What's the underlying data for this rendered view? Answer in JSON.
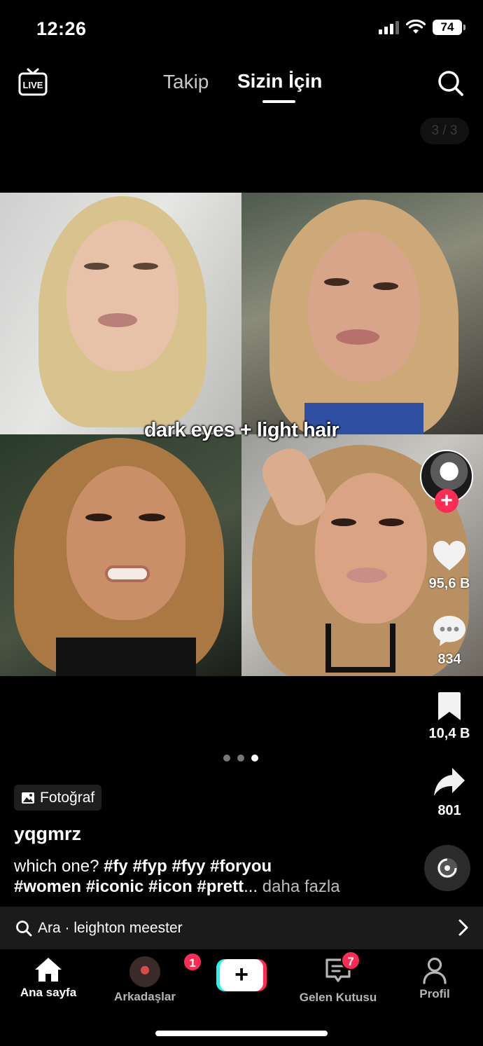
{
  "status_bar": {
    "time": "12:26",
    "battery": "74"
  },
  "top_nav": {
    "live_label": "LIVE",
    "tabs": [
      {
        "label": "Takip",
        "active": false
      },
      {
        "label": "Sizin İçin",
        "active": true
      }
    ],
    "page_counter": "3 / 3"
  },
  "post": {
    "overlay_text": "dark eyes + light hair",
    "carousel": {
      "total": 3,
      "current": 3
    },
    "type_badge": "Fotoğraf",
    "username": "yqgmrz",
    "caption_plain": "which one?",
    "caption_tags_line1": "#fy #fyp #fyy #foryou",
    "caption_tags_line2": "#women #iconic #icon #prett",
    "caption_ellipsis": "...",
    "caption_more": "daha fazla"
  },
  "actions": {
    "likes": "95,6 B",
    "comments": "834",
    "saves": "10,4 B",
    "shares": "801"
  },
  "search_suggestion": {
    "prefix": "Ara",
    "separator": " · ",
    "query": "leighton meester"
  },
  "bottom_nav": {
    "home": "Ana sayfa",
    "friends": "Arkadaşlar",
    "friends_badge": "1",
    "inbox": "Gelen Kutusu",
    "inbox_badge": "7",
    "profile": "Profil"
  },
  "colors": {
    "accent_red": "#fe2c55",
    "accent_cyan": "#25f4ee",
    "background": "#000000"
  }
}
